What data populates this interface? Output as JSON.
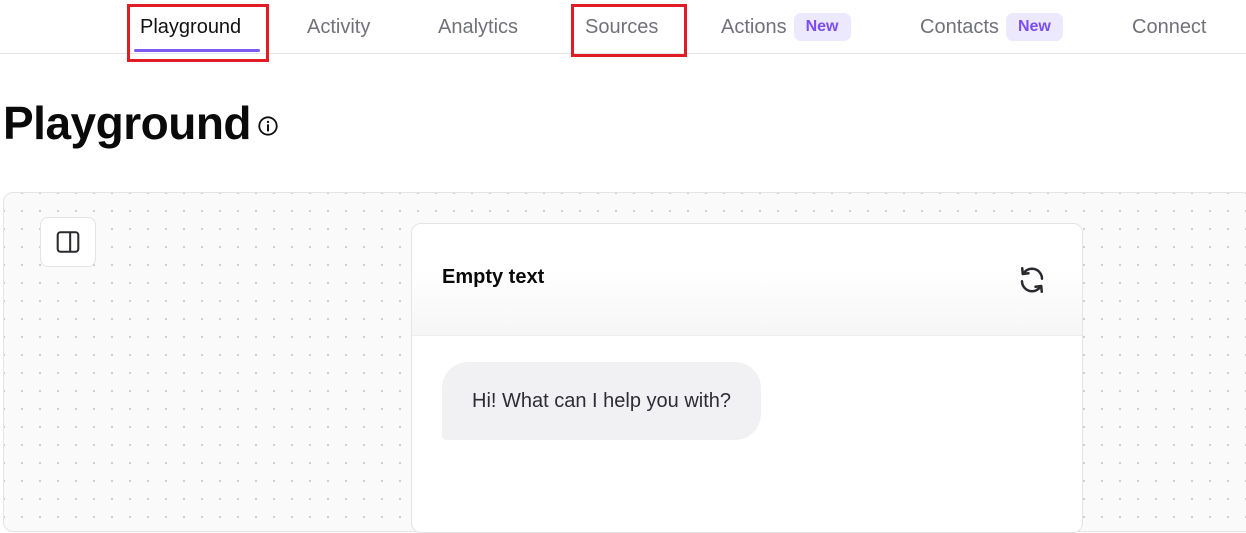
{
  "nav": {
    "items": [
      {
        "label": "Playground"
      },
      {
        "label": "Activity"
      },
      {
        "label": "Analytics"
      },
      {
        "label": "Sources"
      },
      {
        "label": "Actions",
        "badge": "New"
      },
      {
        "label": "Contacts",
        "badge": "New"
      },
      {
        "label": "Connect"
      }
    ],
    "active": "Playground"
  },
  "page": {
    "title": "Playground",
    "info_icon": "info-icon"
  },
  "panel_toggle": {
    "icon": "sidebar-panel-icon"
  },
  "chat": {
    "title": "Empty text",
    "refresh_icon": "refresh-icon",
    "messages": [
      {
        "role": "assistant",
        "text": "Hi! What can I help you with?"
      }
    ]
  },
  "colors": {
    "accent": "#7c5cf0",
    "badge_bg": "#ece8fd",
    "badge_text": "#7c4df0",
    "highlight": "#e01d25",
    "nav_inactive": "#71717a"
  }
}
